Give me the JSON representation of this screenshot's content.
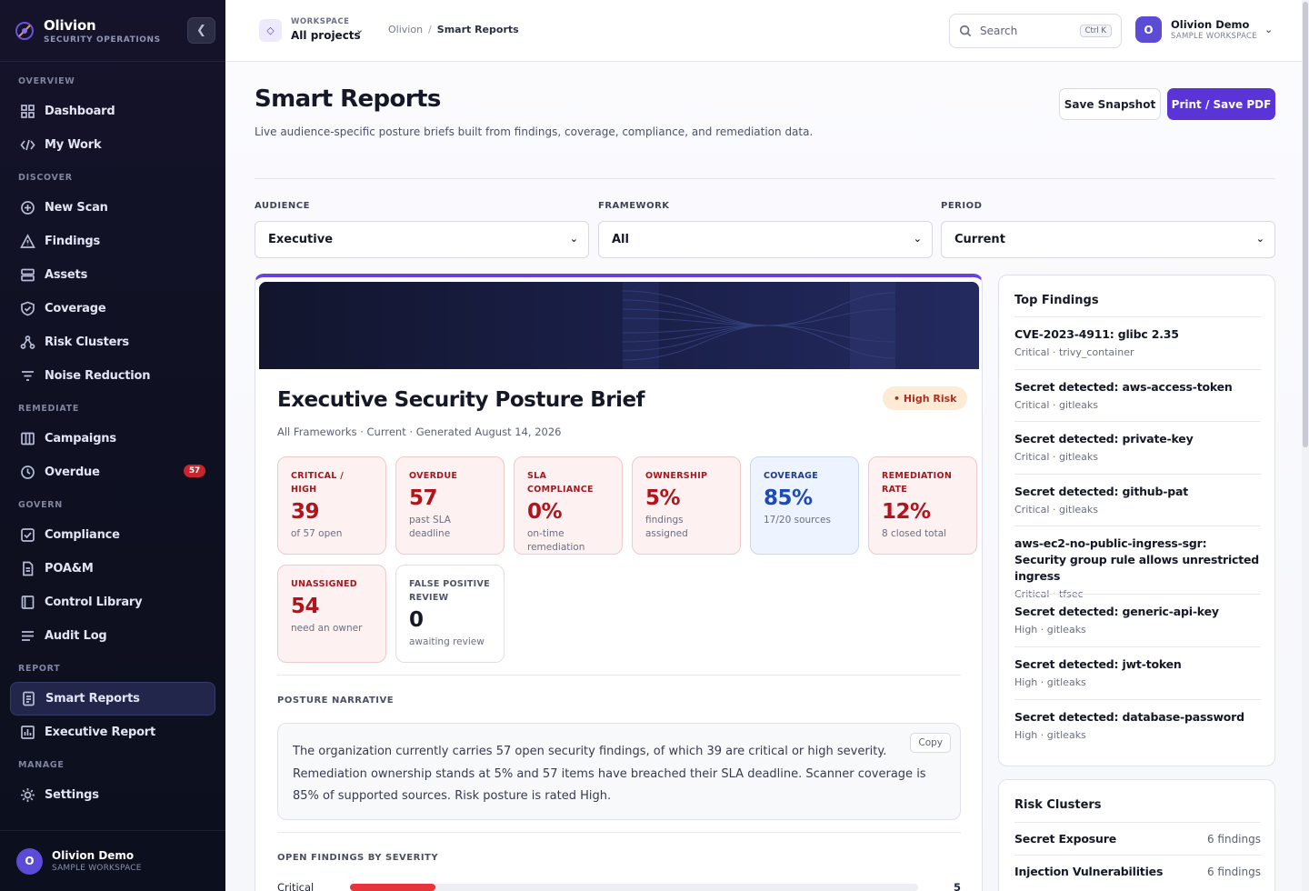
{
  "brand": {
    "name": "Olivion",
    "subtitle": "SECURITY OPERATIONS"
  },
  "sidebar": {
    "sections": [
      {
        "title": "OVERVIEW",
        "items": [
          {
            "label": "Dashboard",
            "icon": "grid-icon"
          },
          {
            "label": "My Work",
            "icon": "code-icon"
          }
        ]
      },
      {
        "title": "DISCOVER",
        "items": [
          {
            "label": "New Scan",
            "icon": "plus-circle-icon"
          },
          {
            "label": "Findings",
            "icon": "warning-icon"
          },
          {
            "label": "Assets",
            "icon": "server-icon"
          },
          {
            "label": "Coverage",
            "icon": "shield-icon"
          },
          {
            "label": "Risk Clusters",
            "icon": "cluster-icon"
          },
          {
            "label": "Noise Reduction",
            "icon": "filter-icon"
          }
        ]
      },
      {
        "title": "REMEDIATE",
        "items": [
          {
            "label": "Campaigns",
            "icon": "columns-icon"
          },
          {
            "label": "Overdue",
            "icon": "clock-icon",
            "badge": "57"
          }
        ]
      },
      {
        "title": "GOVERN",
        "items": [
          {
            "label": "Compliance",
            "icon": "checkbox-icon"
          },
          {
            "label": "POA&M",
            "icon": "document-icon"
          },
          {
            "label": "Control Library",
            "icon": "book-icon"
          },
          {
            "label": "Audit Log",
            "icon": "list-icon"
          }
        ]
      },
      {
        "title": "REPORT",
        "items": [
          {
            "label": "Smart Reports",
            "icon": "report-icon",
            "active": true
          },
          {
            "label": "Executive Report",
            "icon": "bar-chart-icon"
          }
        ]
      },
      {
        "title": "MANAGE",
        "items": [
          {
            "label": "Settings",
            "icon": "sun-gear-icon"
          }
        ]
      }
    ],
    "footer": {
      "avatar": "O",
      "name": "Olivion Demo",
      "workspace": "SAMPLE WORKSPACE"
    }
  },
  "topbar": {
    "workspace_label": "WORKSPACE",
    "workspace_value": "All projects",
    "breadcrumb": [
      "Olivion",
      "Smart Reports"
    ],
    "search_placeholder": "Search",
    "search_shortcut": "Ctrl K",
    "user": {
      "avatar": "O",
      "name": "Olivion Demo",
      "workspace": "SAMPLE WORKSPACE"
    }
  },
  "page": {
    "title": "Smart Reports",
    "subtitle": "Live audience-specific posture briefs built from findings, coverage, compliance, and remediation data.",
    "save_snapshot": "Save Snapshot",
    "print_pdf": "Print / Save PDF"
  },
  "filters": {
    "audience": {
      "label": "AUDIENCE",
      "value": "Executive"
    },
    "framework": {
      "label": "FRAMEWORK",
      "value": "All"
    },
    "period": {
      "label": "PERIOD",
      "value": "Current"
    }
  },
  "report": {
    "title": "Executive Security Posture Brief",
    "risk_badge": "• High Risk",
    "meta": "All Frameworks · Current · Generated August 14, 2026",
    "kpis": [
      {
        "label": "CRITICAL / HIGH",
        "value": "39",
        "sub": "of 57 open",
        "tone": "red"
      },
      {
        "label": "OVERDUE",
        "value": "57",
        "sub": "past SLA deadline",
        "tone": "red"
      },
      {
        "label": "SLA COMPLIANCE",
        "value": "0%",
        "sub": "on-time remediation",
        "tone": "red"
      },
      {
        "label": "OWNERSHIP",
        "value": "5%",
        "sub": "findings assigned",
        "tone": "red"
      },
      {
        "label": "COVERAGE",
        "value": "85%",
        "sub": "17/20 sources",
        "tone": "blue"
      },
      {
        "label": "REMEDIATION RATE",
        "value": "12%",
        "sub": "8 closed total",
        "tone": "red"
      },
      {
        "label": "UNASSIGNED",
        "value": "54",
        "sub": "need an owner",
        "tone": "red"
      },
      {
        "label": "FALSE POSITIVE REVIEW",
        "value": "0",
        "sub": "awaiting review",
        "tone": "gray"
      }
    ],
    "narrative_title": "POSTURE NARRATIVE",
    "narrative": "The organization currently carries 57 open security findings, of which 39 are critical or high severity. Remediation ownership stands at 5% and 57 items have breached their SLA deadline. Scanner coverage is 85% of supported sources. Risk posture is rated High.",
    "copy_label": "Copy",
    "severity_title": "OPEN FINDINGS BY SEVERITY",
    "severity": [
      {
        "name": "Critical",
        "count": "5",
        "fraction": 0.15
      }
    ]
  },
  "top_findings": {
    "title": "Top Findings",
    "items": [
      {
        "title": "CVE-2023-4911: glibc 2.35",
        "sub": "Critical · trivy_container"
      },
      {
        "title": "Secret detected: aws-access-token",
        "sub": "Critical · gitleaks"
      },
      {
        "title": "Secret detected: private-key",
        "sub": "Critical · gitleaks"
      },
      {
        "title": "Secret detected: github-pat",
        "sub": "Critical · gitleaks"
      },
      {
        "title": "aws-ec2-no-public-ingress-sgr: Security group rule allows unrestricted ingress",
        "sub": "Critical · tfsec"
      },
      {
        "title": "Secret detected: generic-api-key",
        "sub": "High · gitleaks"
      },
      {
        "title": "Secret detected: jwt-token",
        "sub": "High · gitleaks"
      },
      {
        "title": "Secret detected: database-password",
        "sub": "High · gitleaks"
      }
    ]
  },
  "risk_clusters": {
    "title": "Risk Clusters",
    "items": [
      {
        "name": "Secret Exposure",
        "count": "6 findings"
      },
      {
        "name": "Injection Vulnerabilities",
        "count": "6 findings"
      }
    ]
  },
  "colors": {
    "accent": "#5a34d6",
    "danger": "#b3141c",
    "coverage": "#1f49b5"
  }
}
